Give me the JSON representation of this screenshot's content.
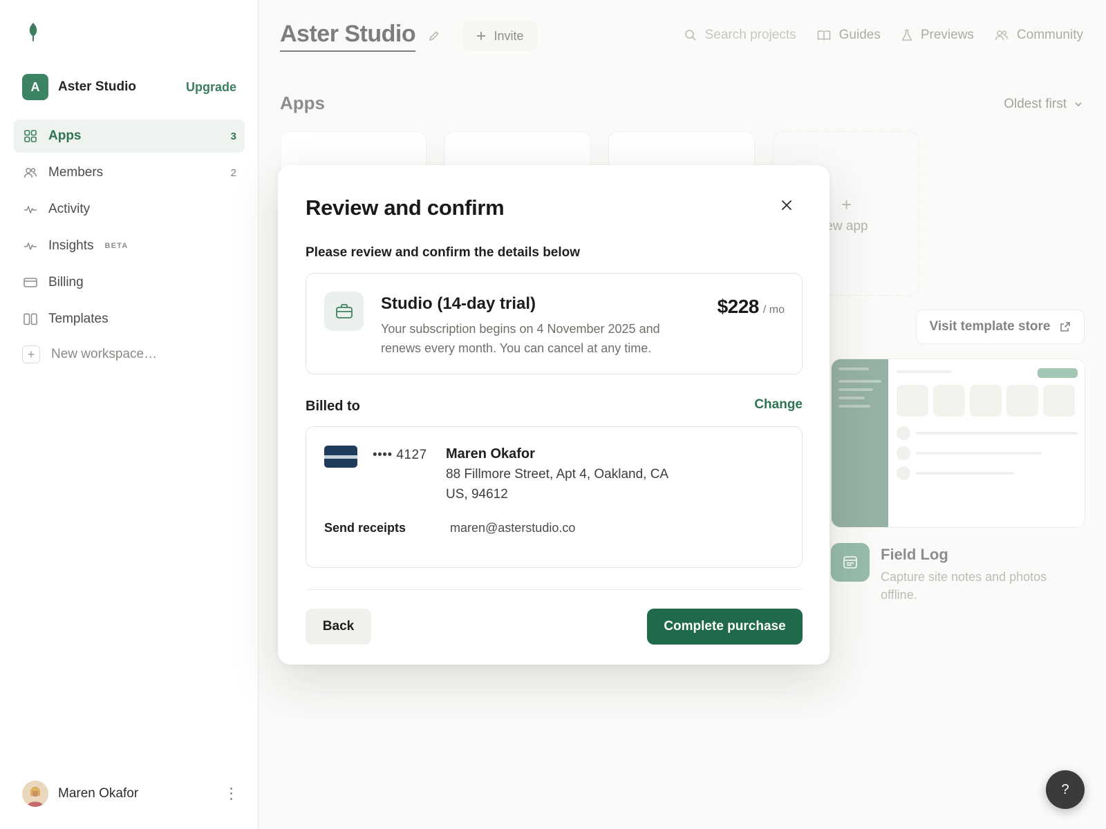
{
  "brand": {
    "accent": "#1e6a4a",
    "accent_soft": "#eff3ef"
  },
  "sidebar": {
    "workspace_initial": "A",
    "workspace_name": "Aster Studio",
    "upgrade_label": "Upgrade",
    "items": [
      {
        "label": "Apps",
        "count": "3",
        "icon": "grid-icon",
        "active": true
      },
      {
        "label": "Members",
        "count": "2",
        "icon": "users-icon"
      },
      {
        "label": "Activity",
        "icon": "pulse-icon"
      },
      {
        "label": "Insights",
        "badge": "BETA",
        "icon": "pulse-icon"
      },
      {
        "label": "Billing",
        "icon": "credit-card-icon"
      },
      {
        "label": "Templates",
        "icon": "columns-icon"
      }
    ],
    "new_workspace_label": "New workspace…",
    "user_name": "Maren Okafor"
  },
  "header": {
    "title": "Aster Studio",
    "invite_label": "Invite",
    "search_placeholder": "Search projects",
    "nav": [
      {
        "label": "Guides",
        "icon": "book-icon"
      },
      {
        "label": "Previews",
        "icon": "flask-icon"
      },
      {
        "label": "Community",
        "icon": "users-icon"
      }
    ]
  },
  "main": {
    "section_title": "Apps",
    "sort_label": "Oldest first",
    "new_app_label": "ew app",
    "visit_store_label": "Visit template store",
    "template": {
      "title": "Field Log",
      "description": "Capture site notes and photos offline."
    },
    "help_label": "?"
  },
  "modal": {
    "title": "Review and confirm",
    "subtitle": "Please review and confirm the details below",
    "plan": {
      "name": "Studio (14-day trial)",
      "description": "Your subscription begins on 4 November 2025 and renews every month. You can cancel at any time.",
      "price": "$228",
      "price_unit": "/ mo"
    },
    "billed_to_label": "Billed to",
    "change_label": "Change",
    "billing": {
      "card_number": "•••• 4127",
      "name": "Maren Okafor",
      "address": "88 Fillmore Street, Apt 4, Oakland, CA US, 94612",
      "receipts_label": "Send receipts",
      "receipts_email": "maren@asterstudio.co"
    },
    "back_label": "Back",
    "complete_label": "Complete purchase"
  }
}
